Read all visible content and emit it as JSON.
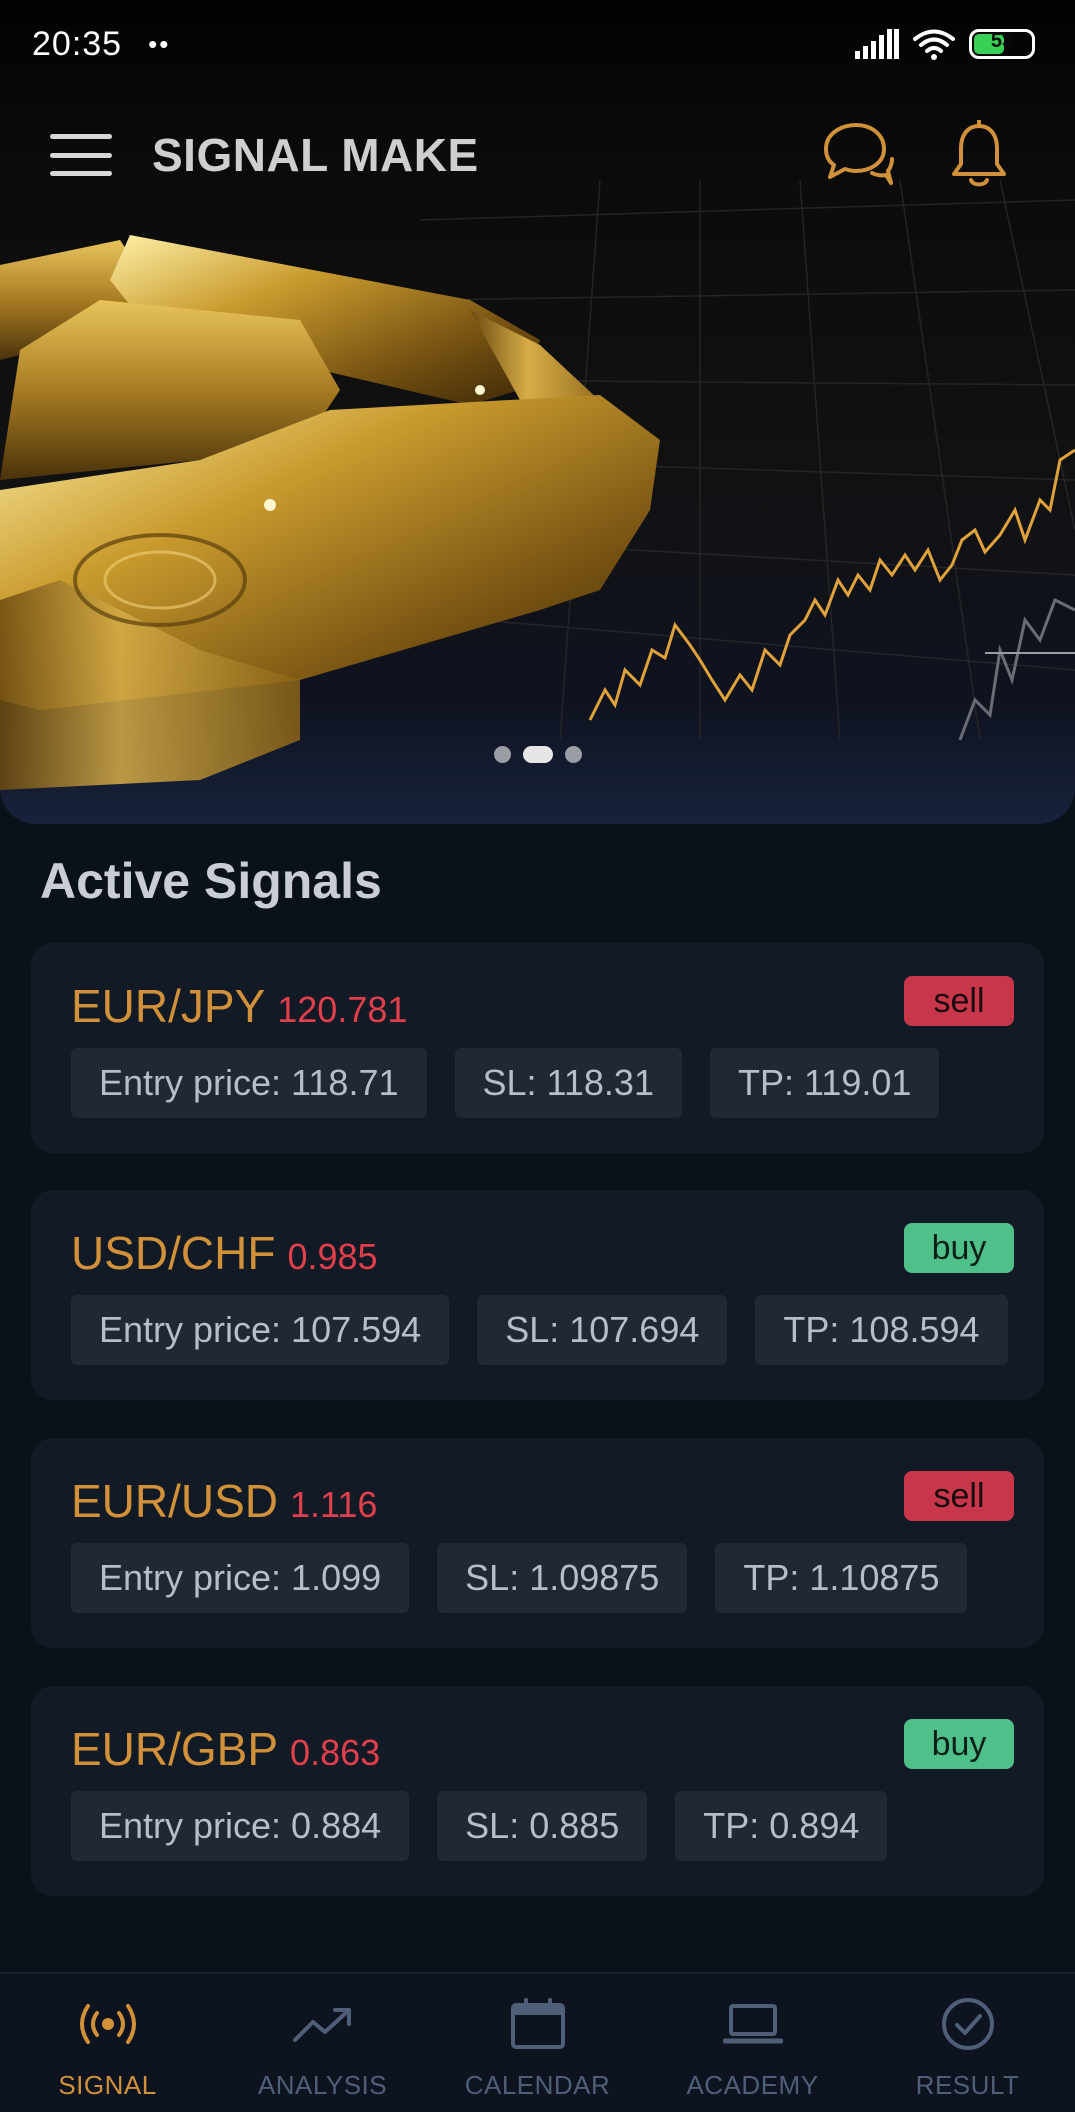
{
  "status_bar": {
    "time": "20:35",
    "dots": "••",
    "battery": "53"
  },
  "app_bar": {
    "title": "SIGNAL MAKE",
    "icons": [
      "menu-icon",
      "chat-icon",
      "bell-icon"
    ]
  },
  "banner": {
    "carousel_dot_count": 3,
    "active_dot_index": 1
  },
  "colors": {
    "accent": "#d0913a",
    "price_red": "#e23f4d",
    "sell": "#c8364a",
    "buy": "#4fc08a",
    "card_bg": "#121a25",
    "chip_bg": "#1f2833"
  },
  "signals": {
    "title": "Active Signals",
    "items": [
      {
        "pair": "EUR/JPY",
        "price": "120.781",
        "action": "sell",
        "entry": "Entry price: 118.71",
        "sl": "SL: 118.31",
        "tp": "TP: 119.01"
      },
      {
        "pair": "USD/CHF",
        "price": "0.985",
        "action": "buy",
        "entry": "Entry price: 107.594",
        "sl": "SL: 107.694",
        "tp": "TP: 108.594"
      },
      {
        "pair": "EUR/USD",
        "price": "1.116",
        "action": "sell",
        "entry": "Entry price: 1.099",
        "sl": "SL: 1.09875",
        "tp": "TP: 1.10875"
      },
      {
        "pair": "EUR/GBP",
        "price": "0.863",
        "action": "buy",
        "entry": "Entry price: 0.884",
        "sl": "SL: 0.885",
        "tp": "TP: 0.894"
      }
    ]
  },
  "bottom_nav": {
    "items": [
      {
        "label": "SIGNAL",
        "icon": "broadcast-icon",
        "active": true
      },
      {
        "label": "ANALYSIS",
        "icon": "trend-up-icon",
        "active": false
      },
      {
        "label": "CALENDAR",
        "icon": "calendar-icon",
        "active": false
      },
      {
        "label": "ACADEMY",
        "icon": "laptop-icon",
        "active": false
      },
      {
        "label": "RESULT",
        "icon": "check-circle-icon",
        "active": false
      }
    ]
  }
}
